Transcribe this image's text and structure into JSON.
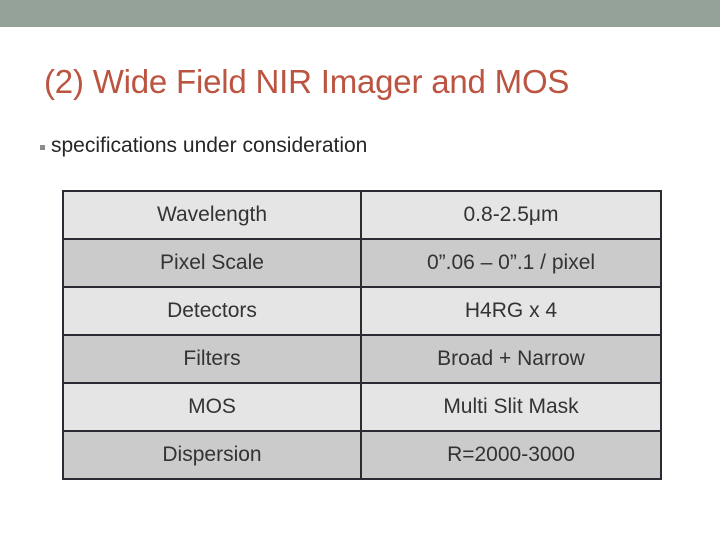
{
  "slide": {
    "accent_bar_color": "#95a299",
    "title": "(2) Wide Field NIR Imager and MOS",
    "title_color": "#bb5440",
    "bullets": [
      {
        "marker": "square-bullet",
        "text": "specifications under consideration"
      }
    ],
    "table": {
      "row_light_color": "#e5e5e5",
      "row_dark_color": "#cbcbcb",
      "border_color": "#2b2b33",
      "rows": [
        {
          "label": "Wavelength",
          "value": "0.8-2.5μm"
        },
        {
          "label": "Pixel Scale",
          "value": "0”.06 – 0”.1 / pixel"
        },
        {
          "label": "Detectors",
          "value": "H4RG x 4"
        },
        {
          "label": "Filters",
          "value": "Broad + Narrow"
        },
        {
          "label": "MOS",
          "value": "Multi Slit Mask"
        },
        {
          "label": "Dispersion",
          "value": "R=2000-3000"
        }
      ]
    }
  }
}
